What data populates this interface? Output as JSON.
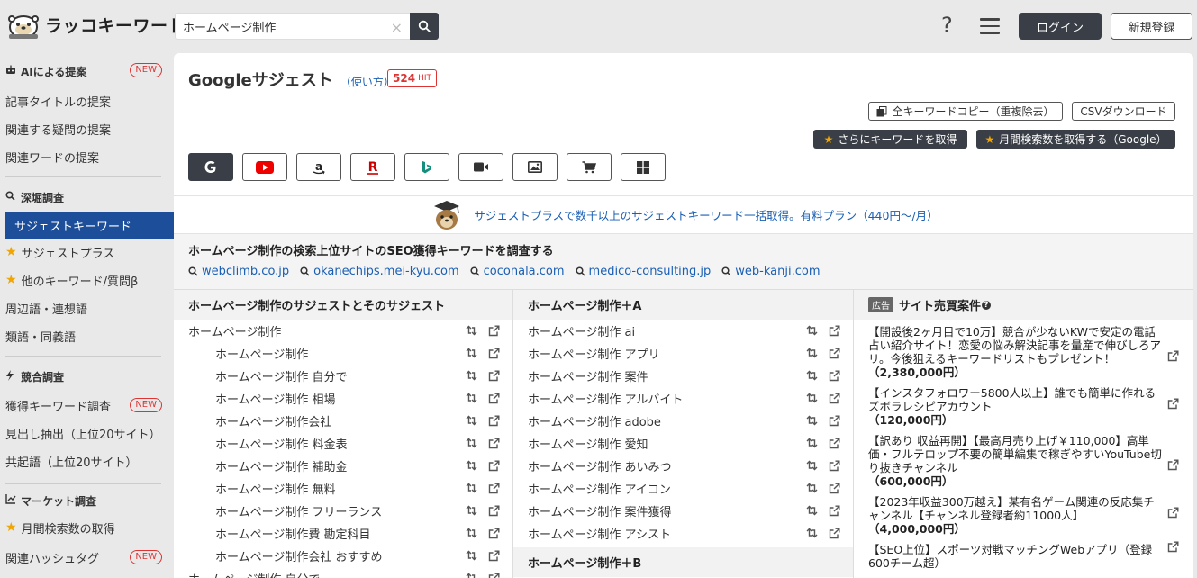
{
  "app": {
    "logo_text": "ラッコキーワード"
  },
  "search": {
    "value": "ホームページ制作",
    "clear": "×"
  },
  "header": {
    "help": "?",
    "login": "ログイン",
    "register": "新規登録"
  },
  "sidebar": {
    "sections": [
      {
        "label": "AIによる提案",
        "badge": "NEW"
      },
      {
        "label": "深堀調査"
      },
      {
        "label": "競合調査"
      },
      {
        "label": "マーケット調査"
      }
    ],
    "items": [
      {
        "label": "記事タイトルの提案"
      },
      {
        "label": "関連する疑問の提案"
      },
      {
        "label": "関連ワードの提案"
      },
      {
        "label": "サジェストキーワード"
      },
      {
        "label": "サジェストプラス"
      },
      {
        "label": "他のキーワード/質問β"
      },
      {
        "label": "周辺語・連想語"
      },
      {
        "label": "類語・同義語"
      },
      {
        "label": "獲得キーワード調査",
        "badge": "NEW"
      },
      {
        "label": "見出し抽出（上位20サイト）"
      },
      {
        "label": "共起語（上位20サイト）"
      },
      {
        "label": "月間検索数の取得"
      },
      {
        "label": "関連ハッシュタグ",
        "badge": "NEW"
      }
    ]
  },
  "main": {
    "title": "Googleサジェスト",
    "howto": "（使い方）",
    "hit_count": "524",
    "hit_unit": "HIT",
    "copy_all": "全キーワードコピー（重複除去）",
    "csv": "CSVダウンロード",
    "more_keywords": "さらにキーワードを取得",
    "monthly": "月間検索数を取得する（Google）",
    "engines": [
      "google-icon",
      "youtube-icon",
      "amazon-icon",
      "rakuten-icon",
      "bing-icon",
      "video-icon",
      "image-icon",
      "shopping-icon",
      "app-store-icon"
    ],
    "promo": "サジェストプラスで数千以上のサジェストキーワード一括取得。有料プラン（440円〜/月）",
    "seo_title": "ホームページ制作の検索上位サイトのSEO獲得キーワードを調査する",
    "seo_links": [
      "webclimb.co.jp",
      "okanechips.mei-kyu.com",
      "coconala.com",
      "medico-consulting.jp",
      "web-kanji.com"
    ]
  },
  "col1": {
    "header": "ホームページ制作のサジェストとそのサジェスト",
    "rows": [
      {
        "text": "ホームページ制作",
        "level": "top"
      },
      {
        "text": "ホームページ制作",
        "level": "sub"
      },
      {
        "text": "ホームページ制作 自分で",
        "level": "sub"
      },
      {
        "text": "ホームページ制作 相場",
        "level": "sub"
      },
      {
        "text": "ホームページ制作会社",
        "level": "sub"
      },
      {
        "text": "ホームページ制作 料金表",
        "level": "sub"
      },
      {
        "text": "ホームページ制作 補助金",
        "level": "sub"
      },
      {
        "text": "ホームページ制作 無料",
        "level": "sub"
      },
      {
        "text": "ホームページ制作 フリーランス",
        "level": "sub"
      },
      {
        "text": "ホームページ制作費 勘定科目",
        "level": "sub"
      },
      {
        "text": "ホームページ制作会社 おすすめ",
        "level": "sub"
      },
      {
        "text": "ホームページ制作 自分で",
        "level": "top"
      }
    ]
  },
  "col2": {
    "header": "ホームページ制作＋A",
    "rows": [
      "ホームページ制作 ai",
      "ホームページ制作 アプリ",
      "ホームページ制作 案件",
      "ホームページ制作 アルバイト",
      "ホームページ制作 adobe",
      "ホームページ制作 愛知",
      "ホームページ制作 あいみつ",
      "ホームページ制作 アイコン",
      "ホームページ制作 案件獲得",
      "ホームページ制作 アシスト"
    ],
    "next_header": "ホームページ制作＋B"
  },
  "col3": {
    "badge": "広告",
    "header": "サイト売買案件",
    "qmark": "?",
    "ads": [
      {
        "text": "【開設後2ヶ月目で10万】競合が少ないKWで安定の電話占い紹介サイト！恋愛の悩み解決記事を量産で伸びしろアリ。今後狙えるキーワードリストもプレゼント！",
        "price": "（2,380,000円）"
      },
      {
        "text": "【インスタフォロワー5800人以上】誰でも簡単に作れるズボラレシピアカウント",
        "price": "（120,000円）"
      },
      {
        "text": "【訳あり 収益再開】【最高月売り上げ￥110,000】高単価・フルテロップ不要の簡単編集で稼ぎやすいYouTube切り抜きチャンネル",
        "price": "（600,000円）"
      },
      {
        "text": "【2023年収益300万越え】某有名ゲーム関連の反応集チャンネル【チャンネル登録者約11000人】",
        "price": "（4,000,000円）"
      },
      {
        "text": "【SEO上位】スポーツ対戦マッチングWebアプリ（登録600チーム超）",
        "price": ""
      }
    ]
  }
}
